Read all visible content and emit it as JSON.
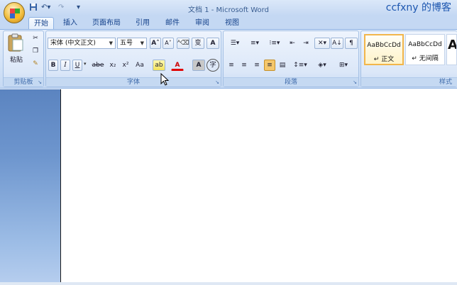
{
  "window": {
    "title": "文档 1 - Microsoft Word",
    "watermark": "ccfxny 的博客"
  },
  "tabs": [
    {
      "label": "开始",
      "active": true
    },
    {
      "label": "插入"
    },
    {
      "label": "页面布局"
    },
    {
      "label": "引用"
    },
    {
      "label": "邮件"
    },
    {
      "label": "审阅"
    },
    {
      "label": "视图"
    }
  ],
  "clipboard": {
    "paste_label": "粘贴",
    "group_label": "剪贴板"
  },
  "font": {
    "font_name": "宋体 (中文正文)",
    "font_size": "五号",
    "group_label": "字体",
    "bold": "B",
    "italic": "I",
    "underline": "U",
    "strike": "abe",
    "subscript": "x₂",
    "superscript": "x²",
    "change_case": "Aa",
    "grow": "A",
    "shrink": "A",
    "font_color": "A",
    "char_shading": "A",
    "enclose": "字",
    "phonetic": "变",
    "border": "A"
  },
  "paragraph": {
    "group_label": "段落"
  },
  "styles": {
    "group_label": "样式",
    "items": [
      {
        "preview": "AaBbCcDd",
        "name": "↵ 正文"
      },
      {
        "preview": "AaBbCcDd",
        "name": "↵ 无间隔"
      },
      {
        "preview": "A",
        "name": ""
      }
    ]
  },
  "colors": {
    "accent": "#15428b",
    "ribbon_bg": "#dbe7f8",
    "left_pane": "#6e96ce"
  }
}
